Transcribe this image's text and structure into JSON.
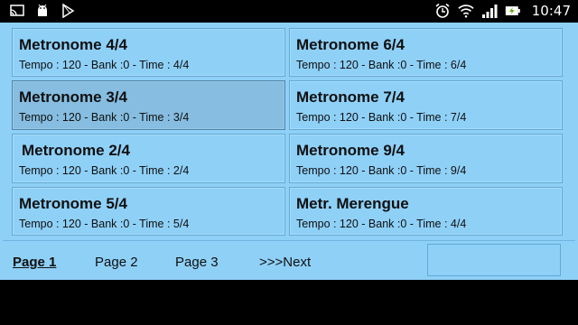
{
  "statusbar": {
    "left_icons": [
      "screencast-icon",
      "android-icon",
      "play-store-icon"
    ],
    "right_icons": [
      "alarm-icon",
      "wifi-icon",
      "signal-icon",
      "battery-charging-icon"
    ],
    "time": "10:47"
  },
  "tiles": [
    {
      "title": "Metronome 4/4",
      "subtitle": "Tempo : 120 - Bank :0 - Time : 4/4",
      "selected": false
    },
    {
      "title": "Metronome 6/4",
      "subtitle": "Tempo : 120 - Bank :0 - Time : 6/4",
      "selected": false
    },
    {
      "title": "Metronome 3/4",
      "subtitle": "Tempo : 120 - Bank :0 - Time : 3/4",
      "selected": true
    },
    {
      "title": "Metronome 7/4",
      "subtitle": "Tempo : 120 - Bank :0 - Time : 7/4",
      "selected": false
    },
    {
      "title": "Metronome 2/4",
      "subtitle": "Tempo : 120 - Bank :0 - Time : 2/4",
      "selected": false
    },
    {
      "title": "Metronome 9/4",
      "subtitle": "Tempo : 120 - Bank :0 - Time : 9/4",
      "selected": false
    },
    {
      "title": "Metronome 5/4",
      "subtitle": "Tempo : 120 - Bank :0 - Time : 5/4",
      "selected": false
    },
    {
      "title": "Metr. Merengue",
      "subtitle": "Tempo : 120 - Bank :0 - Time : 4/4",
      "selected": false
    }
  ],
  "pager": {
    "links": [
      "Page 1",
      "Page 2",
      "Page 3",
      ">>>Next"
    ],
    "active_index": 0
  },
  "colors": {
    "app_background": "#8fd0f7",
    "tile_border": "#62a9d4",
    "selected_tile": "#86bde0"
  }
}
